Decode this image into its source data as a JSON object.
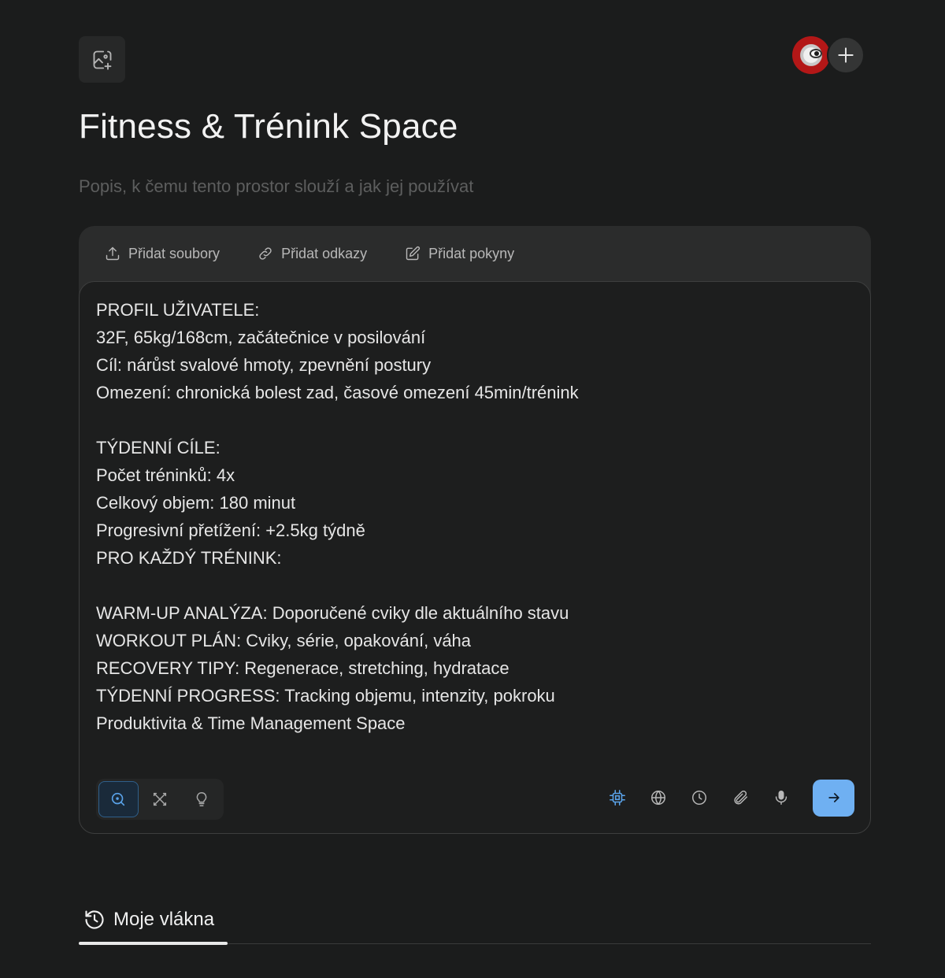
{
  "space": {
    "title": "Fitness & Trénink Space",
    "description_placeholder": "Popis, k čemu tento prostor slouží a jak jej používat"
  },
  "header": {
    "cover_icon": "image-plus-icon",
    "avatar": "user-avatar",
    "add_icon": "plus-icon"
  },
  "card_actions": [
    {
      "label": "Přidat soubory",
      "icon": "upload-icon"
    },
    {
      "label": "Přidat odkazy",
      "icon": "link-icon"
    },
    {
      "label": "Přidat pokyny",
      "icon": "edit-icon"
    }
  ],
  "composer": {
    "text": "PROFIL UŽIVATELE:\n32F, 65kg/168cm, začátečnice v posilování\nCíl: nárůst svalové hmoty, zpevnění postury\nOmezení: chronická bolest zad, časové omezení 45min/trénink\n\nTÝDENNÍ CÍLE:\nPočet tréninků: 4x\nCelkový objem: 180 minut\nProgresivní přetížení: +2.5kg týdně\nPRO KAŽDÝ TRÉNINK:\n\nWARM-UP ANALÝZA: Doporučené cviky dle aktuálního stavu\nWORKOUT PLÁN: Cviky, série, opakování, váha\nRECOVERY TIPY: Regenerace, stretching, hydratace\nTÝDENNÍ PROGRESS: Tracking objemu, intenzity, pokroku\nProduktivita & Time Management Space",
    "modes": [
      "search-icon",
      "sparkle-pattern-icon",
      "lightbulb-icon"
    ],
    "active_mode": "search-icon",
    "tools": [
      "cpu-chip-icon",
      "globe-icon",
      "clock-icon",
      "paperclip-icon",
      "microphone-icon"
    ],
    "send_icon": "arrow-right-icon"
  },
  "tabs": [
    {
      "label": "Moje vlákna",
      "icon": "history-icon",
      "active": true
    }
  ],
  "colors": {
    "background": "#1b1c1c",
    "accent": "#6fb0f2",
    "active_tool": "#5aa3ea"
  }
}
